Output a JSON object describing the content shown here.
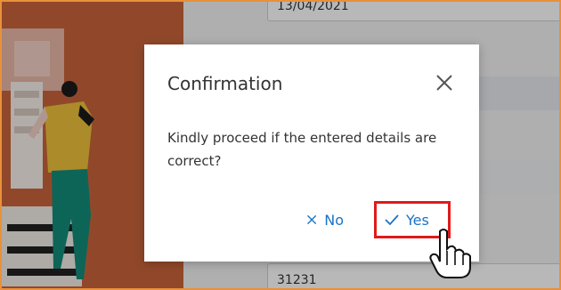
{
  "background": {
    "top_field_value": "13/04/2021",
    "bottom_field_value": "31231"
  },
  "dialog": {
    "title": "Confirmation",
    "message": "Kindly proceed if the entered details are correct?",
    "no_label": "No",
    "yes_label": "Yes",
    "close_icon": "close-icon",
    "no_icon": "close-icon",
    "yes_icon": "check-icon"
  },
  "colors": {
    "accent": "#1a73c5",
    "highlight": "#e11a1a",
    "page_border": "#e8913a"
  }
}
